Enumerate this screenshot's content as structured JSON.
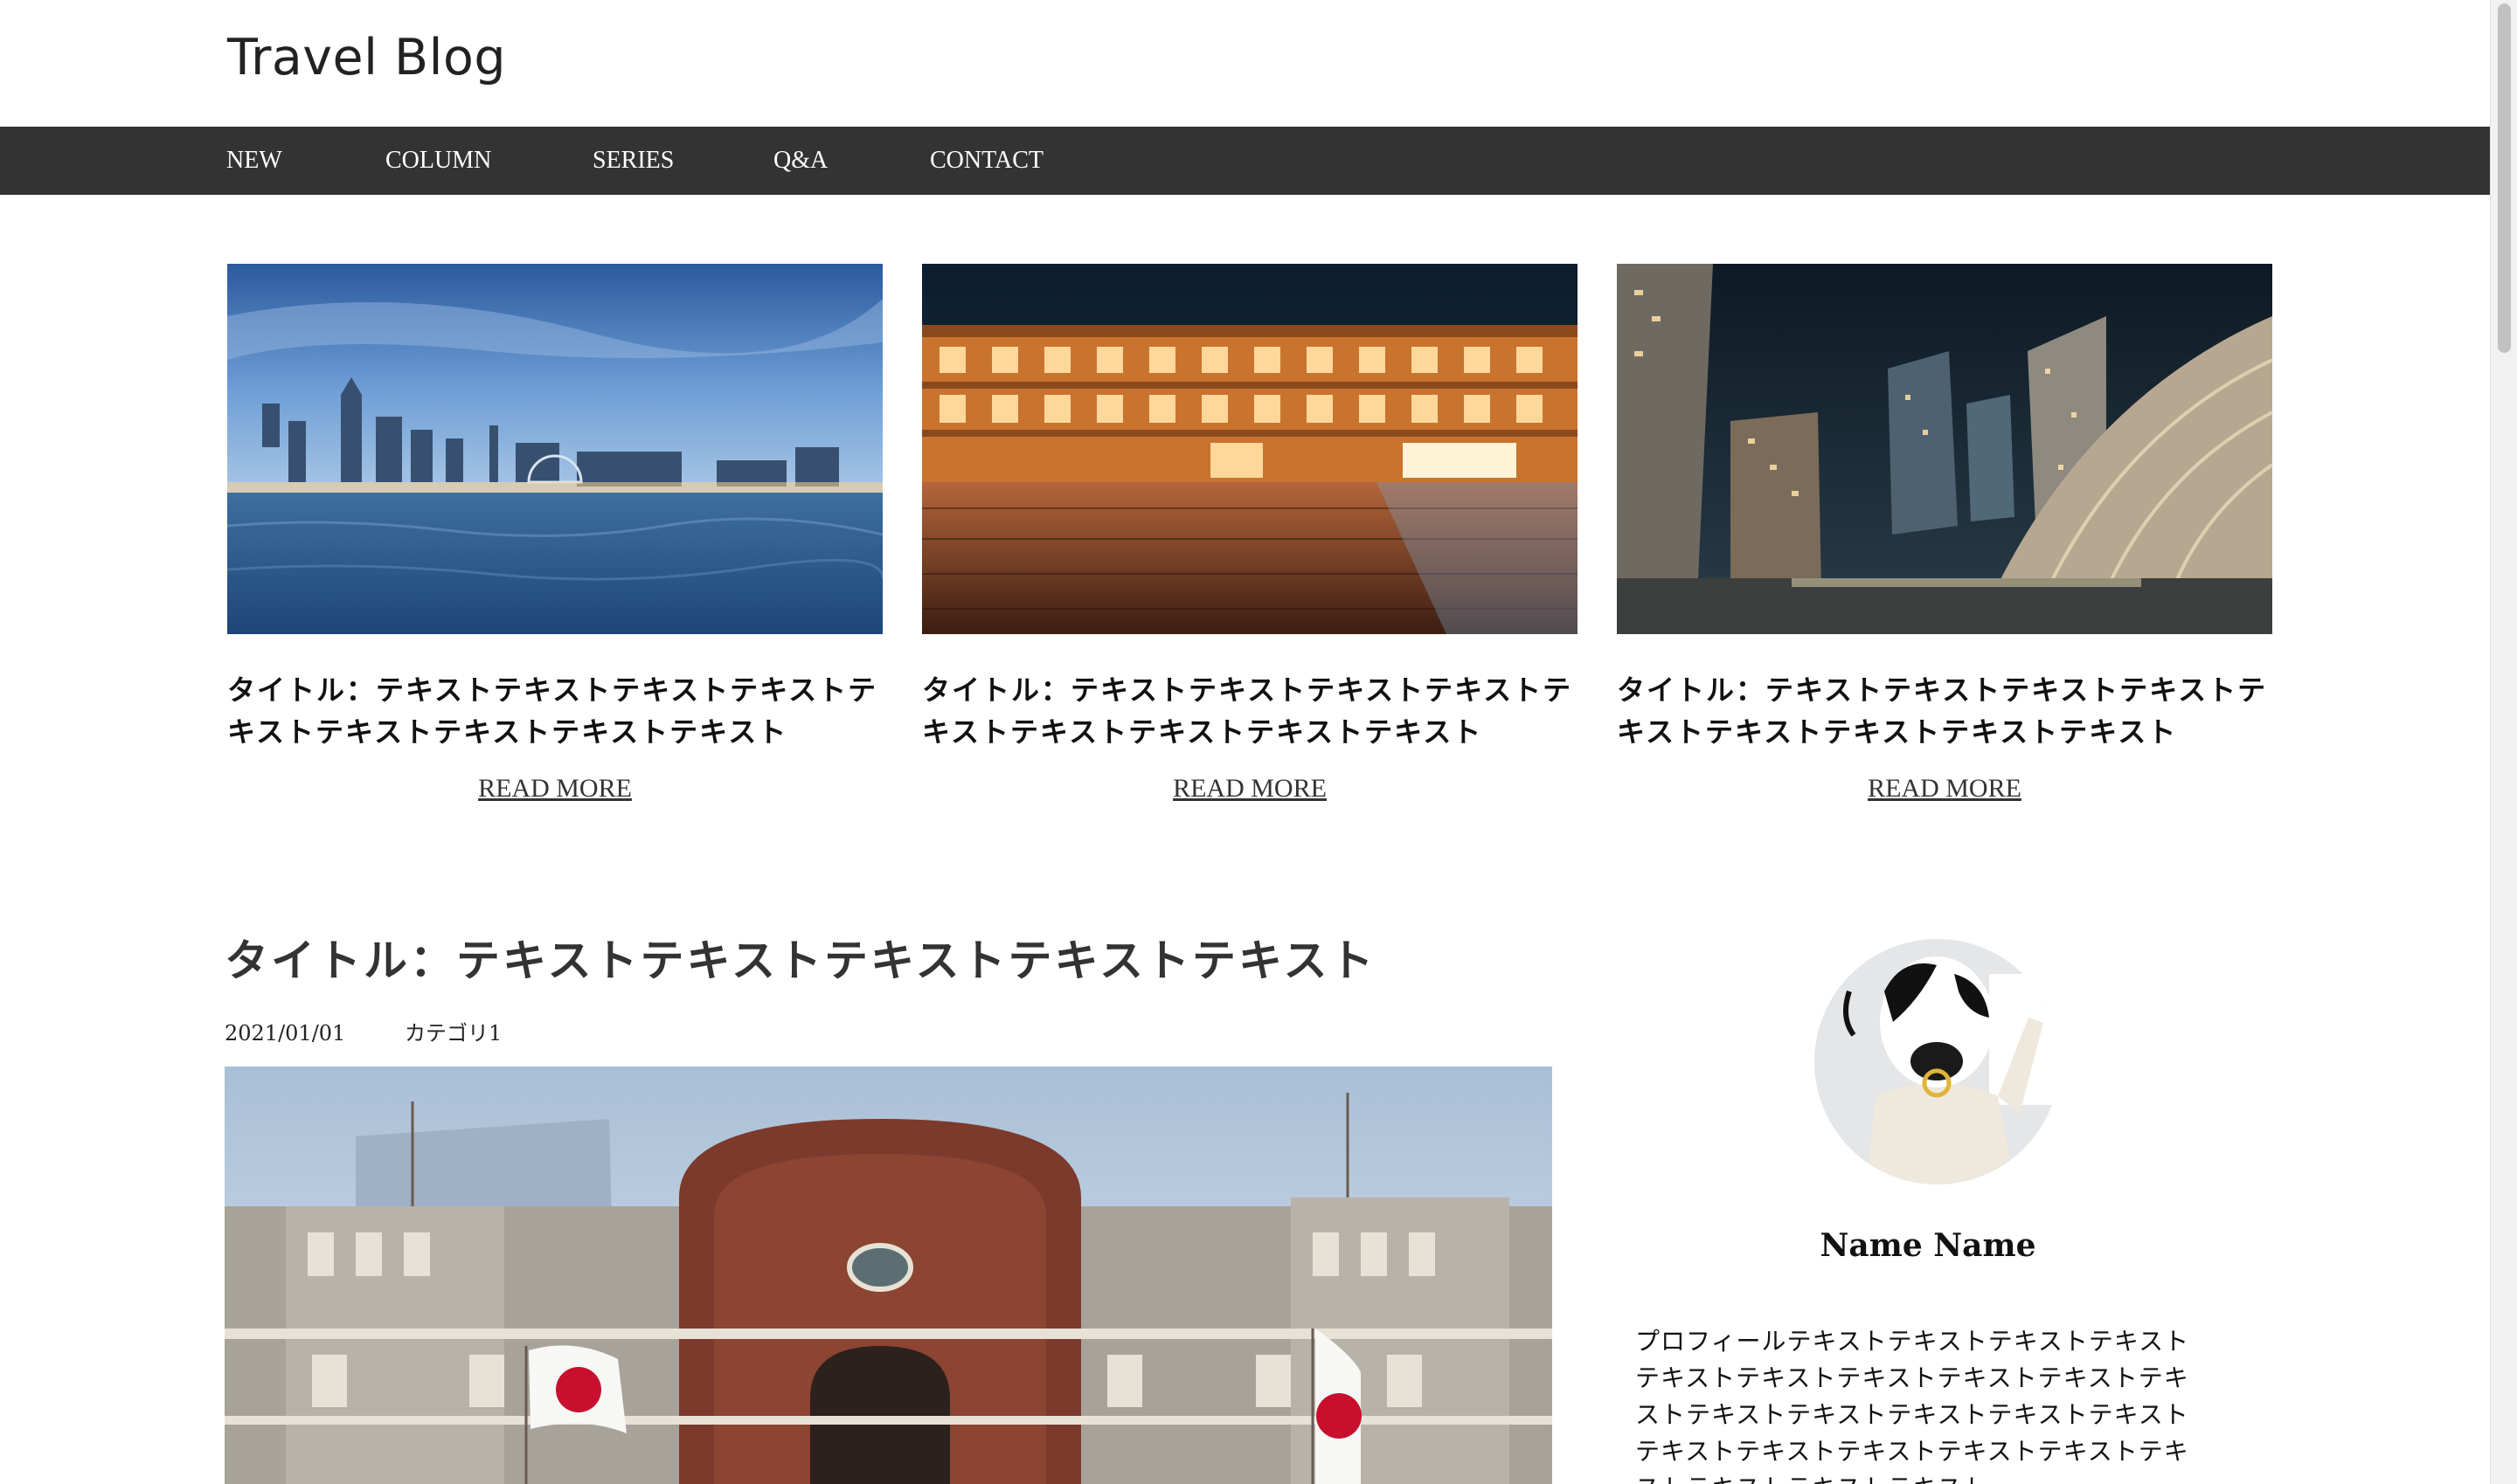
{
  "header": {
    "title": "Travel Blog"
  },
  "nav": {
    "items": [
      {
        "label": "NEW"
      },
      {
        "label": "COLUMN"
      },
      {
        "label": "SERIES"
      },
      {
        "label": "Q&A"
      },
      {
        "label": "CONTACT"
      }
    ]
  },
  "cards": [
    {
      "title": "タイトル：テキストテキストテキストテキストテキストテキストテキストテキストテキスト",
      "read_more": "READ MORE",
      "image": "yokohama-harbor-skyline-photo"
    },
    {
      "title": "タイトル：テキストテキストテキストテキストテキストテキストテキストテキストテキスト",
      "read_more": "READ MORE",
      "image": "red-brick-warehouse-night-photo"
    },
    {
      "title": "タイトル：テキストテキストテキストテキストテキストテキストテキストテキストテキスト",
      "read_more": "READ MORE",
      "image": "city-towers-night-photo"
    }
  ],
  "post": {
    "title": "タイトル：テキストテキストテキストテキストテキスト",
    "date": "2021/01/01",
    "category": "カテゴリ1",
    "image": "tokyo-station-photo"
  },
  "profile": {
    "name": "Name Name",
    "text": "プロフィールテキストテキストテキストテキストテキストテキストテキストテキストテキストテキストテキストテキストテキストテキストテキストテキストテキストテキストテキストテキストテキストテキストテキストテキスト"
  },
  "colors": {
    "nav_bg": "#333333",
    "text": "#111111"
  }
}
